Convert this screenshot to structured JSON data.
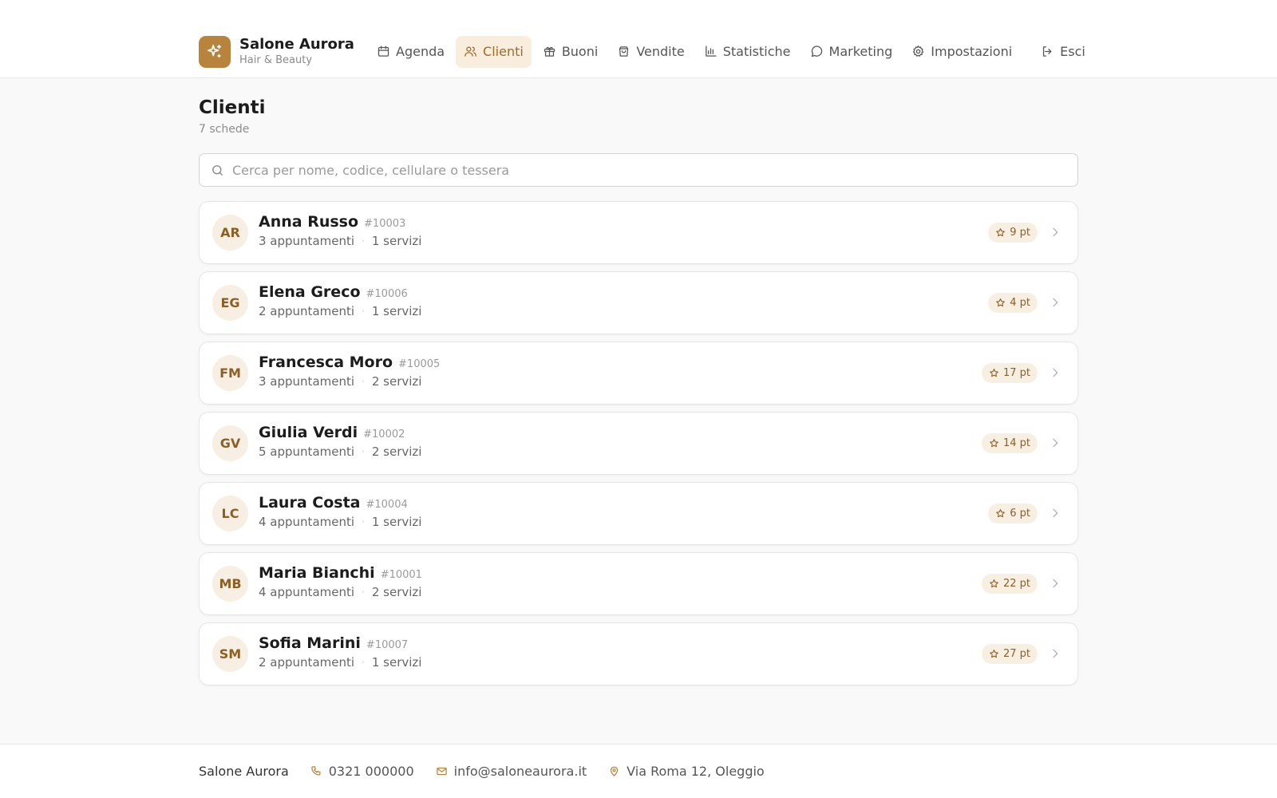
{
  "brand": {
    "name": "Salone Aurora",
    "subtitle": "Hair & Beauty",
    "accent_color": "#b8843c"
  },
  "nav": {
    "items": [
      {
        "label": "Agenda",
        "icon": "calendar-icon",
        "active": false
      },
      {
        "label": "Clienti",
        "icon": "users-icon",
        "active": true
      },
      {
        "label": "Buoni",
        "icon": "gift-icon",
        "active": false
      },
      {
        "label": "Vendite",
        "icon": "shopping-bag-icon",
        "active": false
      },
      {
        "label": "Statistiche",
        "icon": "bar-chart-icon",
        "active": false
      },
      {
        "label": "Marketing",
        "icon": "message-circle-icon",
        "active": false
      },
      {
        "label": "Impostazioni",
        "icon": "gear-icon",
        "active": false
      }
    ],
    "logout_label": "Esci",
    "logout_icon": "logout-icon"
  },
  "page": {
    "title": "Clienti",
    "count_label": "7 schede"
  },
  "search": {
    "placeholder": "Cerca per nome, codice, cellulare o tessera",
    "value": ""
  },
  "clients": [
    {
      "initials": "AR",
      "name": "Anna Russo",
      "code": "#10003",
      "appointments": "3 appuntamenti",
      "services": "1 servizi",
      "points": "9 pt"
    },
    {
      "initials": "EG",
      "name": "Elena Greco",
      "code": "#10006",
      "appointments": "2 appuntamenti",
      "services": "1 servizi",
      "points": "4 pt"
    },
    {
      "initials": "FM",
      "name": "Francesca Moro",
      "code": "#10005",
      "appointments": "3 appuntamenti",
      "services": "2 servizi",
      "points": "17 pt"
    },
    {
      "initials": "GV",
      "name": "Giulia Verdi",
      "code": "#10002",
      "appointments": "5 appuntamenti",
      "services": "2 servizi",
      "points": "14 pt"
    },
    {
      "initials": "LC",
      "name": "Laura Costa",
      "code": "#10004",
      "appointments": "4 appuntamenti",
      "services": "1 servizi",
      "points": "6 pt"
    },
    {
      "initials": "MB",
      "name": "Maria Bianchi",
      "code": "#10001",
      "appointments": "4 appuntamenti",
      "services": "2 servizi",
      "points": "22 pt"
    },
    {
      "initials": "SM",
      "name": "Sofia Marini",
      "code": "#10007",
      "appointments": "2 appuntamenti",
      "services": "1 servizi",
      "points": "27 pt"
    }
  ],
  "footer": {
    "name": "Salone Aurora",
    "phone": "0321 000000",
    "email": "info@saloneaurora.it",
    "address": "Via Roma 12, Oleggio"
  }
}
